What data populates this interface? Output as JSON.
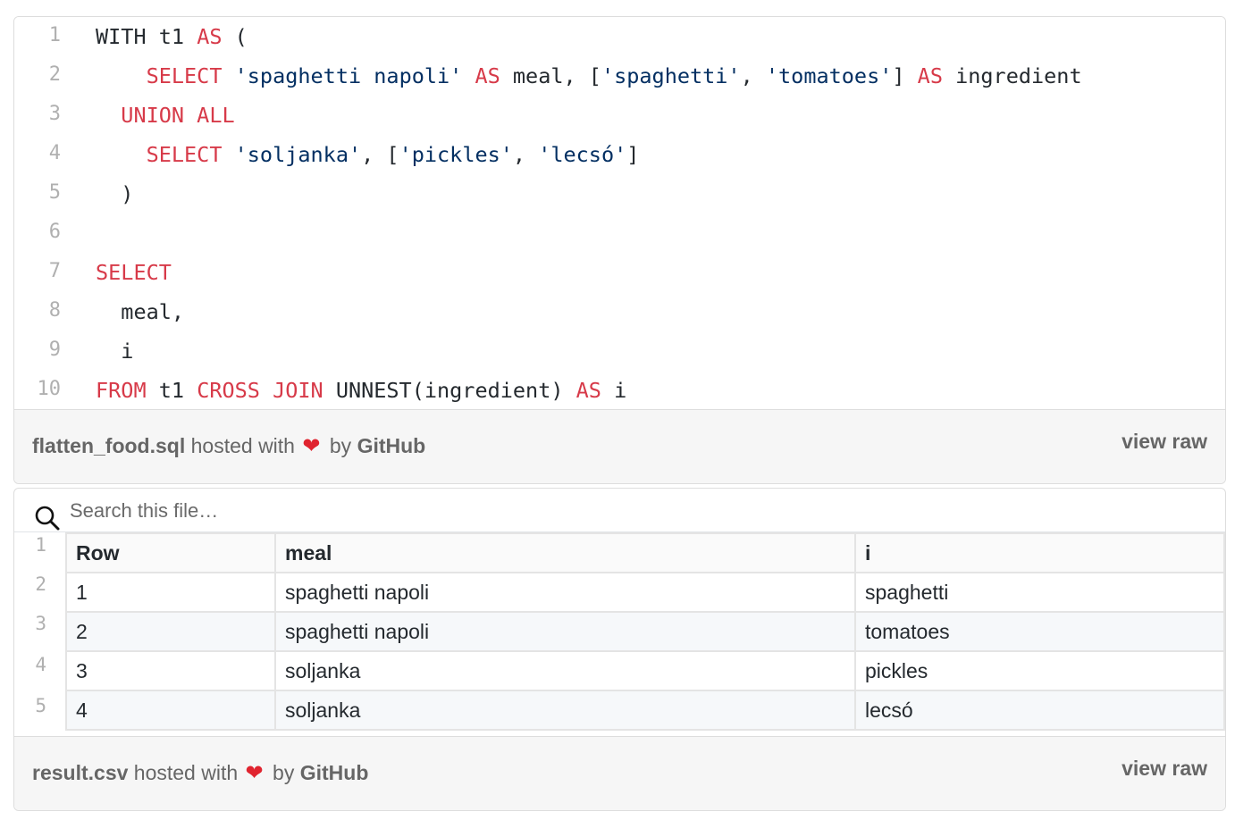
{
  "sql_gist": {
    "lines": [
      {
        "num": "1",
        "tokens": [
          {
            "t": "WITH t1 ",
            "c": "pl"
          },
          {
            "t": "AS",
            "c": "kw"
          },
          {
            "t": " (",
            "c": "pl"
          }
        ]
      },
      {
        "num": "2",
        "tokens": [
          {
            "t": "    ",
            "c": "pl"
          },
          {
            "t": "SELECT",
            "c": "kw"
          },
          {
            "t": " ",
            "c": "pl"
          },
          {
            "t": "'spaghetti napoli'",
            "c": "str"
          },
          {
            "t": " ",
            "c": "pl"
          },
          {
            "t": "AS",
            "c": "kw"
          },
          {
            "t": " meal, [",
            "c": "pl"
          },
          {
            "t": "'spaghetti'",
            "c": "str"
          },
          {
            "t": ", ",
            "c": "pl"
          },
          {
            "t": "'tomatoes'",
            "c": "str"
          },
          {
            "t": "] ",
            "c": "pl"
          },
          {
            "t": "AS",
            "c": "kw"
          },
          {
            "t": " ingredient",
            "c": "pl"
          }
        ]
      },
      {
        "num": "3",
        "tokens": [
          {
            "t": "  ",
            "c": "pl"
          },
          {
            "t": "UNION ALL",
            "c": "kw"
          }
        ]
      },
      {
        "num": "4",
        "tokens": [
          {
            "t": "    ",
            "c": "pl"
          },
          {
            "t": "SELECT",
            "c": "kw"
          },
          {
            "t": " ",
            "c": "pl"
          },
          {
            "t": "'soljanka'",
            "c": "str"
          },
          {
            "t": ", [",
            "c": "pl"
          },
          {
            "t": "'pickles'",
            "c": "str"
          },
          {
            "t": ", ",
            "c": "pl"
          },
          {
            "t": "'lecsó'",
            "c": "str"
          },
          {
            "t": "]",
            "c": "pl"
          }
        ]
      },
      {
        "num": "5",
        "tokens": [
          {
            "t": "  )",
            "c": "pl"
          }
        ]
      },
      {
        "num": "6",
        "tokens": []
      },
      {
        "num": "7",
        "tokens": [
          {
            "t": "SELECT",
            "c": "kw"
          }
        ]
      },
      {
        "num": "8",
        "tokens": [
          {
            "t": "  meal,",
            "c": "pl"
          }
        ]
      },
      {
        "num": "9",
        "tokens": [
          {
            "t": "  i",
            "c": "pl"
          }
        ]
      },
      {
        "num": "10",
        "tokens": [
          {
            "t": "FROM",
            "c": "kw"
          },
          {
            "t": " t1 ",
            "c": "pl"
          },
          {
            "t": "CROSS JOIN",
            "c": "kw"
          },
          {
            "t": " UNNEST(ingredient) ",
            "c": "pl"
          },
          {
            "t": "AS",
            "c": "kw"
          },
          {
            "t": " i",
            "c": "pl"
          }
        ]
      }
    ],
    "meta": {
      "filename": "flatten_food.sql",
      "hosted_with": "hosted with",
      "by": "by",
      "github": "GitHub",
      "view_raw": "view raw"
    }
  },
  "csv_gist": {
    "search_placeholder": "Search this file…",
    "row_numbers": [
      "1",
      "2",
      "3",
      "4",
      "5"
    ],
    "headers": [
      "Row",
      "meal",
      "i"
    ],
    "rows": [
      [
        "1",
        "spaghetti napoli",
        "spaghetti"
      ],
      [
        "2",
        "spaghetti napoli",
        "tomatoes"
      ],
      [
        "3",
        "soljanka",
        "pickles"
      ],
      [
        "4",
        "soljanka",
        "lecsó"
      ]
    ],
    "meta": {
      "filename": "result.csv",
      "hosted_with": "hosted with",
      "by": "by",
      "github": "GitHub",
      "view_raw": "view raw"
    }
  },
  "colors": {
    "keyword": "#d73a49",
    "string": "#032f62",
    "heart": "#e0242f"
  },
  "icons": {
    "heart": "heart-icon",
    "search": "search-icon"
  }
}
